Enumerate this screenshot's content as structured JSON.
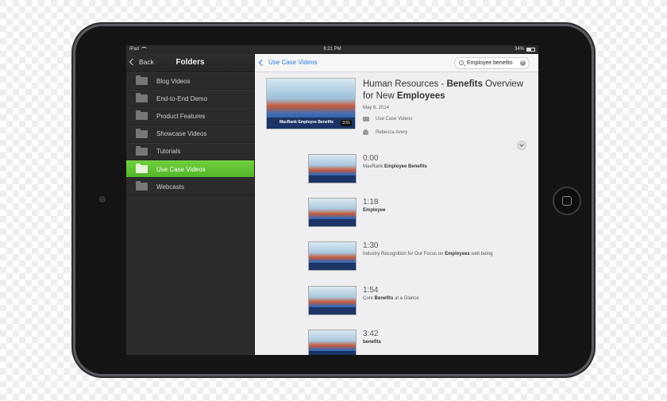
{
  "status_bar": {
    "device": "iPad",
    "time": "6:21 PM",
    "battery": "34%"
  },
  "sidebar": {
    "back_label": "Back",
    "title": "Folders",
    "items": [
      {
        "label": "Blog Videos",
        "active": false
      },
      {
        "label": "End-to-End Demo",
        "active": false
      },
      {
        "label": "Product Features",
        "active": false
      },
      {
        "label": "Showcase Videos",
        "active": false
      },
      {
        "label": "Tutorials",
        "active": false
      },
      {
        "label": "Use Case Videos",
        "active": true
      },
      {
        "label": "Webcasts",
        "active": false
      }
    ]
  },
  "main": {
    "back_label": "Use Case Videos",
    "search_value": "Employee benefits",
    "featured": {
      "title_parts": [
        "Human Resources - ",
        "Benefits",
        " Overview for New ",
        "Employees"
      ],
      "date": "May 6, 2014",
      "folder": "Use Case Videos",
      "author": "Rebecca Avery",
      "thumb_title": "MaxRank Employee Benefits",
      "duration": "3:51"
    },
    "chapters": [
      {
        "time": "0:00",
        "desc_plain": "MaxRank ",
        "desc_bold": "Employee Benefits",
        "desc_tail": ""
      },
      {
        "time": "1:18",
        "desc_plain": "",
        "desc_bold": "Employee",
        "desc_tail": ""
      },
      {
        "time": "1:30",
        "desc_plain": "Industry Recognition for Our Focus on ",
        "desc_bold": "Employees",
        "desc_tail": " well-being"
      },
      {
        "time": "1:54",
        "desc_plain": "Core ",
        "desc_bold": "Benefits",
        "desc_tail": " at a Glance"
      },
      {
        "time": "3:42",
        "desc_plain": "",
        "desc_bold": "benefits",
        "desc_tail": ""
      }
    ]
  },
  "colors": {
    "accent_green": "#5cbf2e",
    "link_blue": "#2d7cd8",
    "sidebar_bg": "#2b2b2b"
  }
}
